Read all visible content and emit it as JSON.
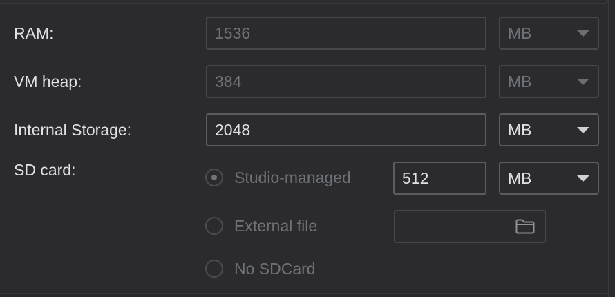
{
  "rows": {
    "ram": {
      "label": "RAM:",
      "value": "1536",
      "unit": "MB"
    },
    "vm_heap": {
      "label": "VM heap:",
      "value": "384",
      "unit": "MB"
    },
    "internal_storage": {
      "label": "Internal Storage:",
      "value": "2048",
      "unit": "MB"
    },
    "sd_card": {
      "label": "SD card:",
      "options": {
        "studio_managed": {
          "label": "Studio-managed",
          "checked": true,
          "value": "512",
          "unit": "MB"
        },
        "external_file": {
          "label": "External file",
          "checked": false,
          "value": ""
        },
        "no_sdcard": {
          "label": "No SDCard",
          "checked": false
        }
      }
    }
  },
  "icons": {
    "folder": "folder-icon",
    "dropdown": "chevron-down-icon"
  },
  "colors": {
    "background": "#2b2b2d",
    "text": "#dfe1e5",
    "disabled_text": "#6f7278",
    "border": "#4e5157"
  }
}
